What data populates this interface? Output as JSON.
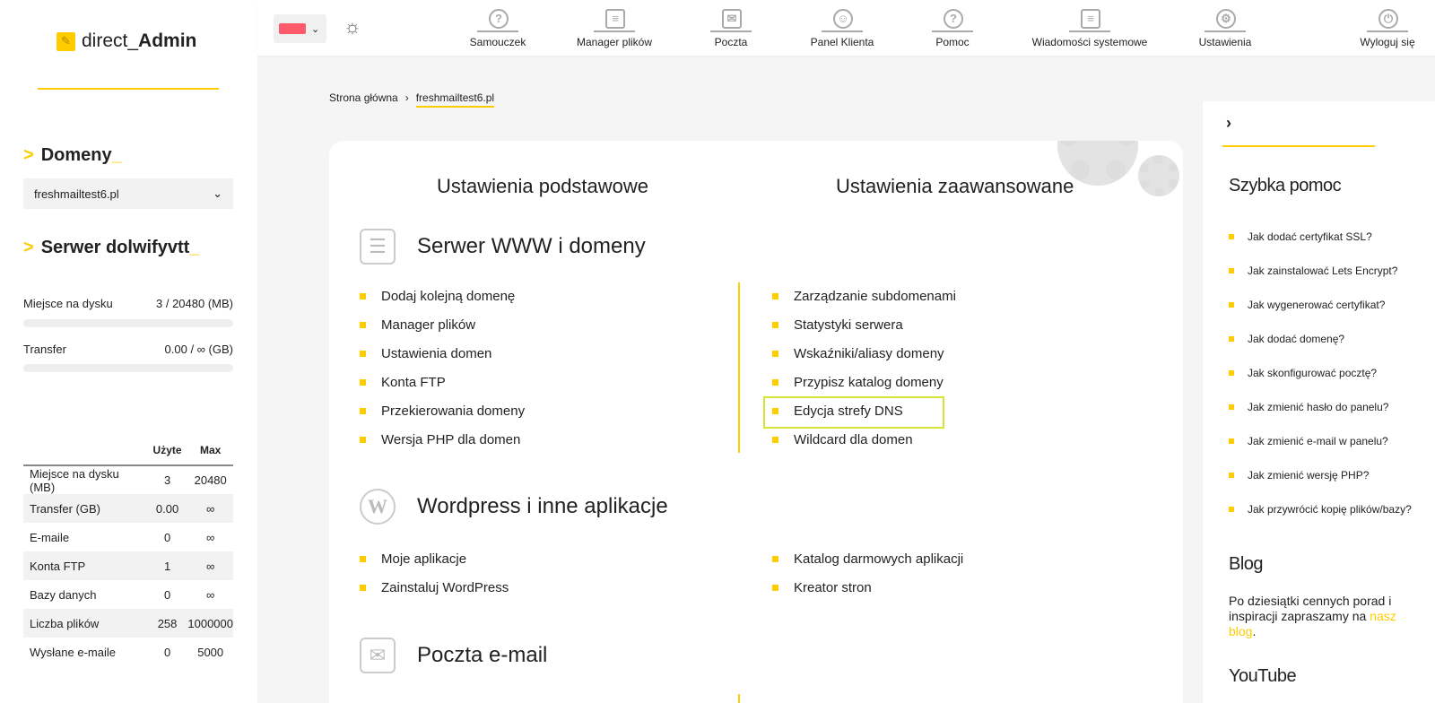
{
  "logo": {
    "prefix": "direct_",
    "bold": "Admin"
  },
  "sidebar": {
    "domains_heading": "Domeny",
    "selected_domain": "freshmailtest6.pl",
    "server_heading": "Serwer dolwifyvtt",
    "disk_label": "Miejsce na dysku",
    "disk_value": "3 / 20480 (MB)",
    "disk_usage_fraction": 0.0001,
    "transfer_label": "Transfer",
    "transfer_value": "0.00 / ∞ (GB)",
    "transfer_usage_fraction": 0,
    "table_headers": [
      "",
      "Użyte",
      "Max"
    ],
    "table_rows": [
      [
        "Miejsce na dysku (MB)",
        "3",
        "20480"
      ],
      [
        "Transfer (GB)",
        "0.00",
        "∞"
      ],
      [
        "E-maile",
        "0",
        "∞"
      ],
      [
        "Konta FTP",
        "1",
        "∞"
      ],
      [
        "Bazy danych",
        "0",
        "∞"
      ],
      [
        "Liczba plików",
        "258",
        "1000000"
      ],
      [
        "Wysłane e-maile",
        "0",
        "5000"
      ]
    ]
  },
  "topnav": {
    "items": [
      {
        "label": "Samouczek",
        "icon": "tutorial-icon"
      },
      {
        "label": "Manager plików",
        "icon": "file-manager-icon"
      },
      {
        "label": "Poczta",
        "icon": "mail-icon"
      },
      {
        "label": "Panel Klienta",
        "icon": "client-panel-icon"
      },
      {
        "label": "Pomoc",
        "icon": "help-icon"
      },
      {
        "label": "Wiadomości systemowe",
        "icon": "system-messages-icon"
      },
      {
        "label": "Ustawienia",
        "icon": "settings-icon"
      },
      {
        "label": "Wyloguj się",
        "icon": "logout-icon"
      }
    ]
  },
  "breadcrumb": {
    "home": "Strona główna",
    "current": "freshmailtest6.pl"
  },
  "main": {
    "tab_basic": "Ustawienia podstawowe",
    "tab_advanced": "Ustawienia zaawansowane",
    "sections": [
      {
        "title": "Serwer WWW i domeny",
        "left": [
          "Dodaj kolejną domenę",
          "Manager plików",
          "Ustawienia domen",
          "Konta FTP",
          "Przekierowania domeny",
          "Wersja PHP dla domen"
        ],
        "right": [
          "Zarządzanie subdomenami",
          "Statystyki serwera",
          "Wskaźniki/aliasy domeny",
          "Przypisz katalog domeny",
          "Edycja strefy DNS",
          "Wildcard dla domen"
        ]
      },
      {
        "title": "Wordpress i inne aplikacje",
        "left": [
          "Moje aplikacje",
          "Zainstaluj WordPress"
        ],
        "right": [
          "Katalog darmowych aplikacji",
          "Kreator stron"
        ]
      },
      {
        "title": "Poczta e-mail",
        "left": [],
        "right": []
      }
    ]
  },
  "right_panel": {
    "chevron": "›",
    "quick_help_title": "Szybka pomoc",
    "help_links": [
      "Jak dodać certyfikat SSL?",
      "Jak zainstalować Lets Encrypt?",
      "Jak wygenerować certyfikat?",
      "Jak dodać domenę?",
      "Jak skonfigurować pocztę?",
      "Jak zmienić hasło do panelu?",
      "Jak zmienić e-mail w panelu?",
      "Jak zmienić wersję PHP?",
      "Jak przywrócić kopię plików/bazy?"
    ],
    "blog_title": "Blog",
    "blog_text": "Po dziesiątki cennych porad i inspiracji zapraszamy na",
    "blog_link": "nasz blog",
    "youtube_title": "YouTube"
  },
  "colors": {
    "accent": "#ffcc00",
    "highlight": "#d4e23a"
  }
}
